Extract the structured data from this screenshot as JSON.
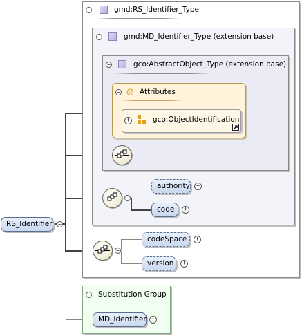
{
  "root": {
    "label": "RS_Identifier",
    "expander": "⊖"
  },
  "types": {
    "rs": {
      "title": "gmd:RS_Identifier_Type",
      "icon": "complex-type-icon"
    },
    "md": {
      "title": "gmd:MD_Identifier_Type (extension base)",
      "icon": "complex-type-icon"
    },
    "abstract": {
      "title": "gco:AbstractObject_Type (extension base)",
      "icon": "complex-type-icon"
    }
  },
  "attributes": {
    "title": "Attributes",
    "icon": "at-sign-icon",
    "group": {
      "label": "gco:ObjectIdentification",
      "icon": "attribute-group-icon",
      "link_icon": "external-link-icon"
    }
  },
  "sequences": {
    "md_children": [
      {
        "label": "authority"
      },
      {
        "label": "code"
      }
    ],
    "rs_children": [
      {
        "label": "codeSpace"
      },
      {
        "label": "version"
      }
    ]
  },
  "substitution": {
    "title": "Substitution Group",
    "member": {
      "label": "MD_Identifier"
    }
  },
  "symbols": {
    "collapse": "−",
    "expand": "+"
  },
  "colors": {
    "element_fill": "#c9d8ee",
    "attribute_fill": "#fff3db",
    "substitution_fill": "#f0fff0",
    "type_icon": "#b9b2e0"
  }
}
